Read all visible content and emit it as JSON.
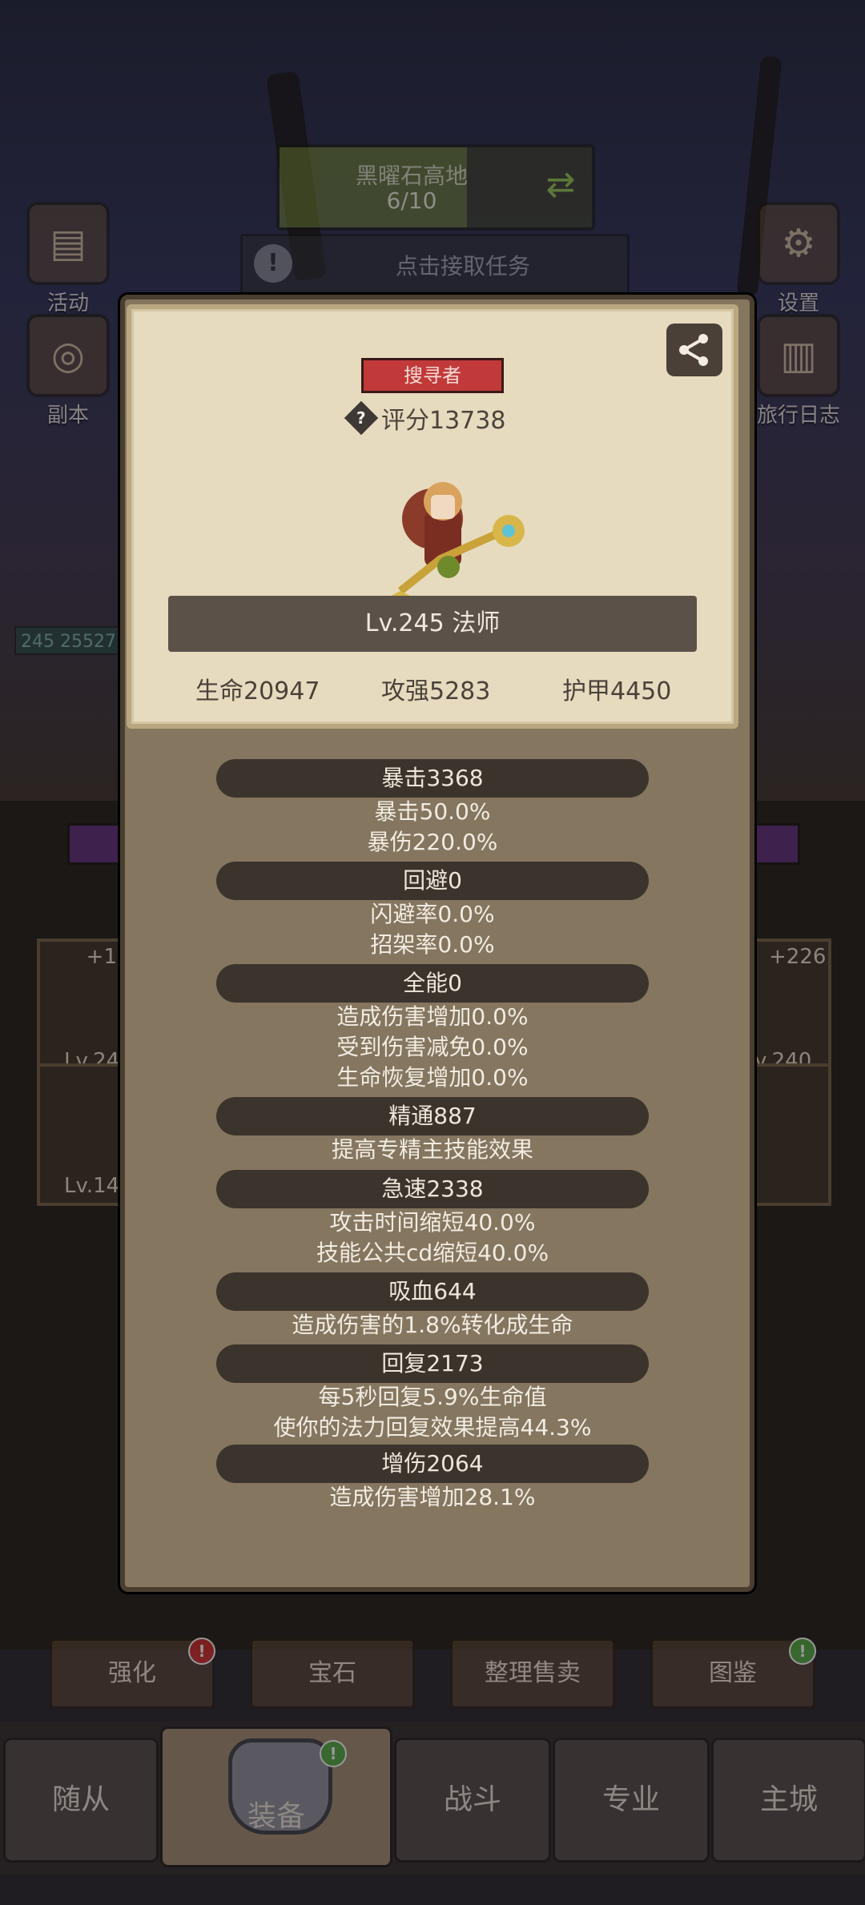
{
  "hud": {
    "zone_name": "黑曜石高地",
    "zone_progress": "6/10",
    "zone_progress_fraction": 0.6,
    "task_text": "点击接取任务",
    "task_icon_glyph": "!"
  },
  "side_left": [
    {
      "label": "活动",
      "icon": "scroll-icon"
    },
    {
      "label": "副本",
      "icon": "portal-icon"
    }
  ],
  "side_right": [
    {
      "label": "设置",
      "icon": "gear-icon"
    },
    {
      "label": "旅行日志",
      "icon": "book-icon"
    }
  ],
  "hp_chip": {
    "level": "245",
    "value": "25527"
  },
  "equip": {
    "left_top": {
      "plus": "+1",
      "lv": "Lv.24("
    },
    "left_bottom": {
      "lv": "Lv.14("
    },
    "right_top": {
      "plus": "+226",
      "lv": "v.240"
    }
  },
  "profile": {
    "role_tag": "搜寻者",
    "score_glyph": "?",
    "score": "评分13738",
    "level_class": "Lv.245 法师",
    "hp": "生命20947",
    "attack": "攻强5283",
    "armor": "护甲4450"
  },
  "stats": [
    {
      "header": "暴击3368",
      "lines": [
        "暴击50.0%",
        "暴伤220.0%"
      ]
    },
    {
      "header": "回避0",
      "lines": [
        "闪避率0.0%",
        "招架率0.0%"
      ]
    },
    {
      "header": "全能0",
      "lines": [
        "造成伤害增加0.0%",
        "受到伤害减免0.0%",
        "生命恢复增加0.0%"
      ]
    },
    {
      "header": "精通887",
      "lines": [
        "提高专精主技能效果"
      ]
    },
    {
      "header": "急速2338",
      "lines": [
        "攻击时间缩短40.0%",
        "技能公共cd缩短40.0%"
      ]
    },
    {
      "header": "吸血644",
      "lines": [
        "造成伤害的1.8%转化成生命"
      ]
    },
    {
      "header": "回复2173",
      "lines": [
        "每5秒回复5.9%生命值",
        "使你的法力回复效果提高44.3%"
      ]
    },
    {
      "header": "增伤2064",
      "lines": [
        "造成伤害增加28.1%"
      ]
    }
  ],
  "action_buttons": [
    {
      "label": "强化",
      "badge": "!"
    },
    {
      "label": "宝石"
    },
    {
      "label": "整理售卖"
    },
    {
      "label": "图鉴",
      "badge": "!"
    }
  ],
  "bottom_nav": [
    {
      "label": "随从"
    },
    {
      "label": "装备",
      "badge": "!"
    },
    {
      "label": "战斗"
    },
    {
      "label": "专业"
    },
    {
      "label": "主城"
    }
  ],
  "colors": {
    "role_tag": "#c13a39",
    "badge_red": "#c82727",
    "badge_green": "#4ea83d",
    "card": "#e7dbbf"
  }
}
